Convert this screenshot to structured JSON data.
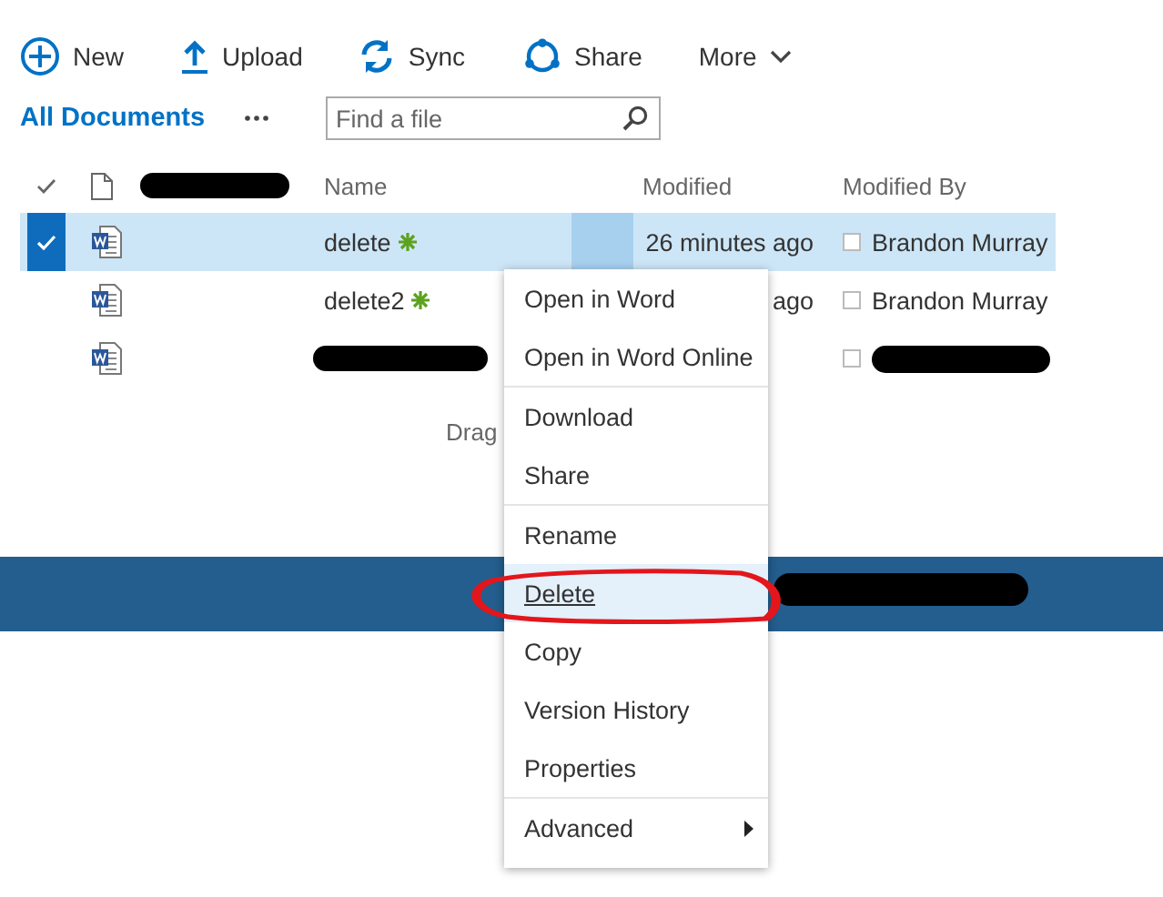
{
  "toolbar": [
    {
      "kind": "new",
      "label": "New"
    },
    {
      "kind": "upload",
      "label": "Upload"
    },
    {
      "kind": "sync",
      "label": "Sync"
    },
    {
      "kind": "share",
      "label": "Share"
    },
    {
      "kind": "more",
      "label": "More"
    }
  ],
  "view": {
    "title": "All Documents"
  },
  "search": {
    "placeholder": "Find a file"
  },
  "columns": [
    "Name",
    "Modified",
    "Modified By"
  ],
  "rows": [
    {
      "name": "delete",
      "is_new": true,
      "modified": "26 minutes ago",
      "modified_by": "Brandon Murray",
      "selected": true
    },
    {
      "name": "delete2",
      "is_new": true,
      "modified": "ago",
      "modified_by": "Brandon Murray",
      "selected": false
    },
    {
      "is_new": false,
      "selected": false
    }
  ],
  "drop_hint": "Drag",
  "context_menu": {
    "groups": [
      [
        {
          "label": "Open in Word",
          "selected": false
        },
        {
          "label": "Open in Word Online",
          "selected": false
        }
      ],
      [
        {
          "label": "Download",
          "selected": false
        },
        {
          "label": "Share",
          "selected": false
        }
      ],
      [
        {
          "label": "Rename",
          "selected": false
        },
        {
          "label": "Delete",
          "selected": true
        },
        {
          "label": "Copy",
          "selected": false
        },
        {
          "label": "Version History",
          "selected": false
        },
        {
          "label": "Properties",
          "selected": false
        }
      ],
      [
        {
          "label": "Advanced",
          "selected": false,
          "submenu": true
        }
      ]
    ]
  }
}
